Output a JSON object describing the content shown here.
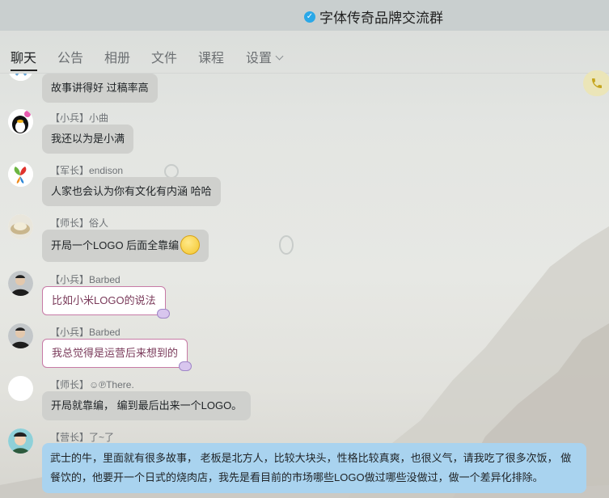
{
  "window": {
    "title": "字体传奇品牌交流群"
  },
  "tabs": [
    {
      "label": "聊天",
      "active": true
    },
    {
      "label": "公告"
    },
    {
      "label": "相册"
    },
    {
      "label": "文件"
    },
    {
      "label": "课程"
    },
    {
      "label": "设置"
    }
  ],
  "toolbar": {
    "call_icon": "phone-icon"
  },
  "messages": [
    {
      "text": "故事讲得好  过稿率高"
    },
    {
      "sender": "【小兵】小曲",
      "text": "我还以为是小满"
    },
    {
      "sender": "【军长】endison",
      "text": "人家也会认为你有文化有内涵  哈哈"
    },
    {
      "sender": "【师长】俗人",
      "text": "开局一个LOGO  后面全靠编",
      "emoji": "smile-emoji"
    },
    {
      "sender": "【小兵】Barbed",
      "text": "比如小米LOGO的说法"
    },
    {
      "sender": "【小兵】Barbed",
      "text": "我总觉得是运营后来想到的"
    },
    {
      "sender": "【师长】☺℗There.",
      "text": "开局就靠编，  编到最后出来一个LOGO。"
    },
    {
      "sender": "【营长】了~了",
      "text": "武士的牛，里面就有很多故事，  老板是北方人，比较大块头，性格比较真爽，也很义气，请我吃了很多次饭，  做餐饮的，他要开一个日式的烧肉店，我先是看目前的市场哪些LOGO做过哪些没做过，做一个差异化排除。"
    }
  ]
}
